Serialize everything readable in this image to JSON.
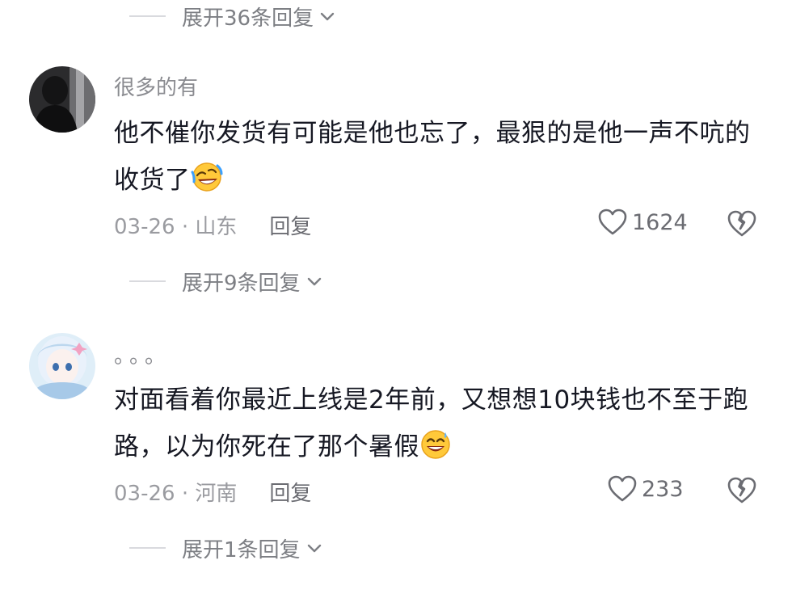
{
  "thread": {
    "top_expand_label": "展开36条回复",
    "comments": [
      {
        "username": "很多的有",
        "text": "他不催你发货有可能是他也忘了，最狠的是他一声不吭的收货了",
        "emoji": "rolling-on-floor-laughing-emoji",
        "date_location": "03-26 · 山东",
        "reply_label": "回复",
        "likes": "1624",
        "expand_label": "展开9条回复"
      },
      {
        "username": "。。。",
        "text": "对面看着你最近上线是2年前，又想想10块钱也不至于跑路，以为你死在了那个暑假",
        "emoji": "grinning-sweat-emoji",
        "date_location": "03-26 · 河南",
        "reply_label": "回复",
        "likes": "233",
        "expand_label": "展开1条回复"
      }
    ]
  },
  "colors": {
    "text_primary": "#161823",
    "text_secondary": "#8a8b90",
    "divider": "#d9dade"
  }
}
